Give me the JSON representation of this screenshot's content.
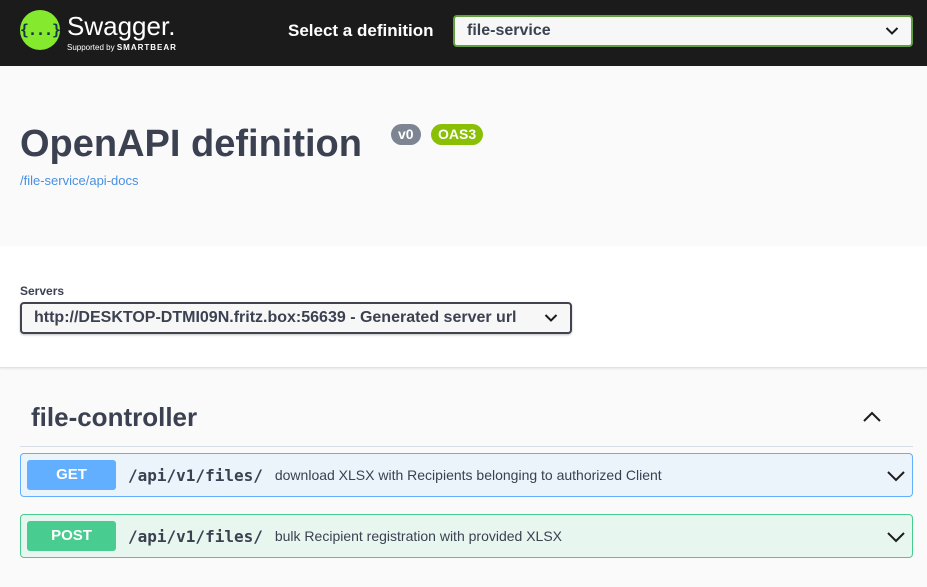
{
  "topbar": {
    "logo_glyph": "{...}",
    "brand": "Swagger",
    "brand_mark": ".",
    "supported_by": "Supported by",
    "smartbear": "SMARTBEAR",
    "select_label": "Select a definition",
    "selected_definition": "file-service",
    "icon": "chevron-down-icon"
  },
  "info": {
    "title": "OpenAPI definition",
    "version_badge": "v0",
    "oas_badge": "OAS3",
    "api_docs_link": "/file-service/api-docs"
  },
  "servers": {
    "label": "Servers",
    "selected": "http://DESKTOP-DTMI09N.fritz.box:56639 - Generated server url"
  },
  "controller": {
    "name": "file-controller",
    "expanded": true,
    "operations": [
      {
        "method": "GET",
        "path": "/api/v1/files/",
        "summary": "download XLSX with Recipients belonging to authorized Client"
      },
      {
        "method": "POST",
        "path": "/api/v1/files/",
        "summary": "bulk Recipient registration with provided XLSX"
      }
    ]
  },
  "colors": {
    "topbar_bg": "#1b1b1b",
    "logo_green": "#85ea2d",
    "get": "#61affe",
    "post": "#49cc90",
    "oas_badge": "#89bf04",
    "version_badge": "#7d8492",
    "link": "#4990e2"
  }
}
